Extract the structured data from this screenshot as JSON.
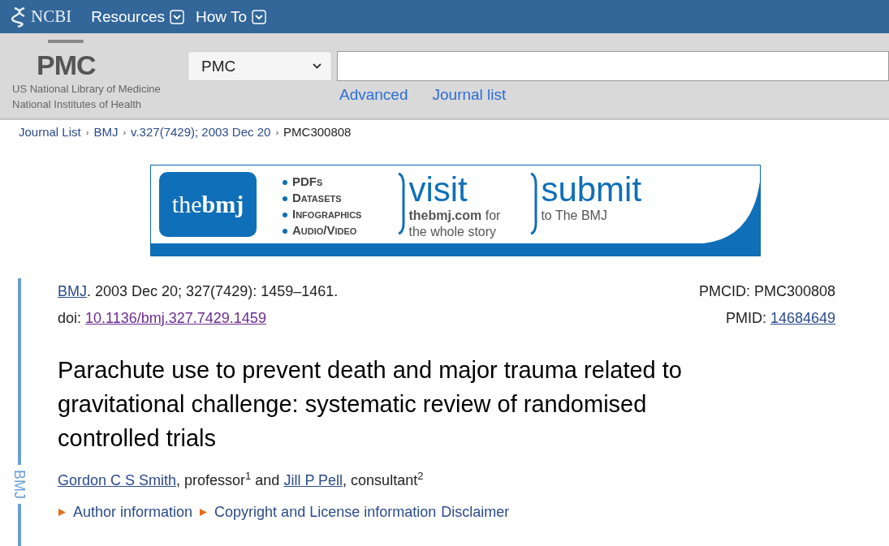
{
  "top_bar": {
    "logo": "NCBI",
    "menus": [
      {
        "label": "Resources"
      },
      {
        "label": "How To"
      }
    ]
  },
  "header": {
    "logo": "PMC",
    "org_lines": [
      "US National Library of Medicine",
      "National Institutes of Health"
    ],
    "database_select": "PMC",
    "links": [
      "Advanced",
      "Journal list"
    ]
  },
  "breadcrumb_separator": "›",
  "breadcrumb": [
    {
      "label": "Journal List",
      "link": true
    },
    {
      "label": "BMJ",
      "link": true
    },
    {
      "label": "v.327(7429); 2003 Dec 20",
      "link": true
    },
    {
      "label": "PMC300808",
      "link": false
    }
  ],
  "banner": {
    "logo_light": "the",
    "logo_bold": "bmj",
    "bullets": [
      "PDFs",
      "Datasets",
      "Infographics",
      "Audio/Video"
    ],
    "visit": {
      "big": "visit",
      "bold": "thebmj.com",
      "rest": "for",
      "line2": "the whole story"
    },
    "submit": {
      "big": "submit",
      "small": "to The BMJ"
    }
  },
  "article": {
    "side_label": "BMJ",
    "journal": "BMJ",
    "citation": ". 2003 Dec 20; 327(7429): 1459–1461.",
    "doi_label": "doi: ",
    "doi": "10.1136/bmj.327.7429.1459",
    "pmcid": "PMCID: PMC300808",
    "pmid_label": "PMID: ",
    "pmid": "14684649",
    "title": "Parachute use to prevent death and major trauma related to gravitational challenge: systematic review of randomised controlled trials",
    "authors": [
      {
        "name": "Gordon C S Smith",
        "role": ", professor$^{1}$"
      },
      {
        "name": "Jill P Pell",
        "role": ", consultant$^{2}$"
      }
    ],
    "author_joiner": " and ",
    "sections": [
      "Author information",
      "Copyright and License information"
    ],
    "disclaimer": "Disclaimer"
  }
}
